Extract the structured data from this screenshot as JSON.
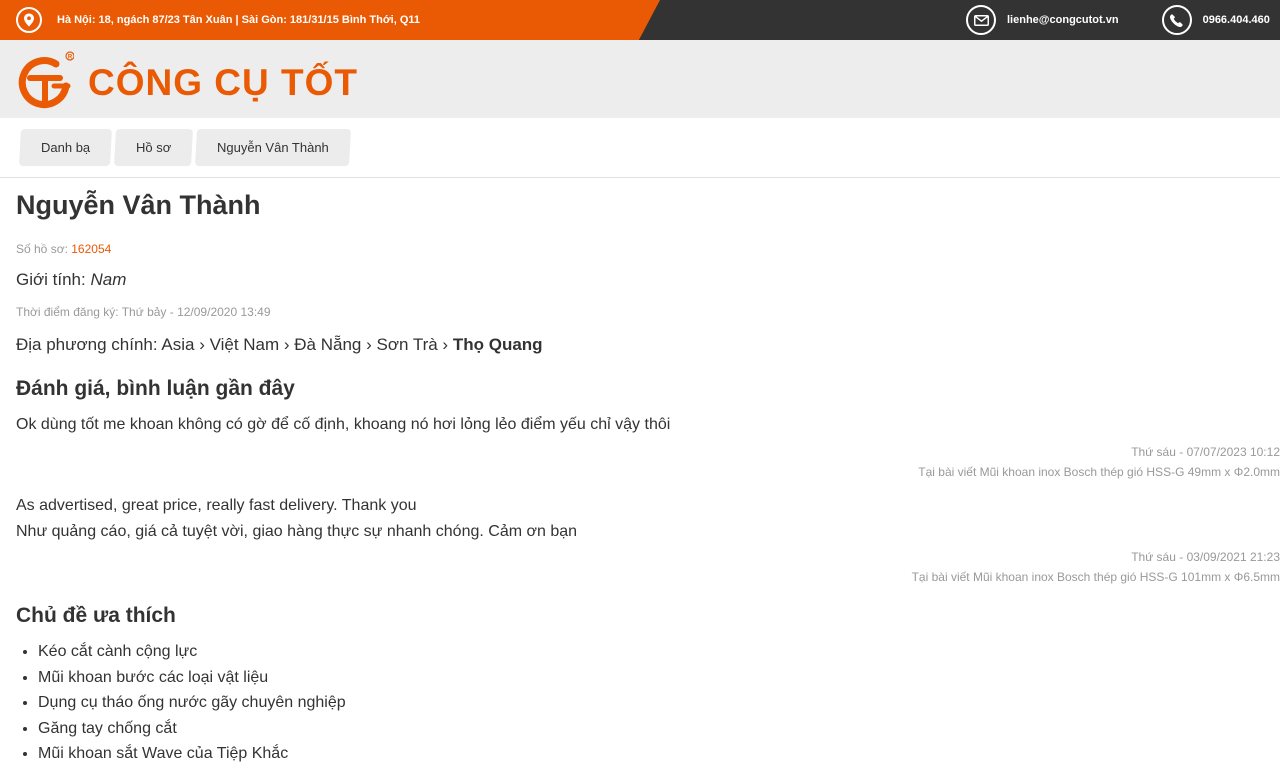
{
  "topbar": {
    "address": "Hà Nội: 18, ngách 87/23 Tân Xuân | Sài Gòn: 181/31/15 Bình Thới, Q11",
    "email": "lienhe@congcutot.vn",
    "phone": "0966.404.460"
  },
  "logo": {
    "text": "CÔNG CỤ TỐT",
    "mark_letters": "GT",
    "registered": "®"
  },
  "breadcrumb": [
    "Danh bạ",
    "Hồ sơ",
    "Nguyễn Vân Thành"
  ],
  "profile": {
    "name": "Nguyễn Vân Thành",
    "profile_no_label": "Số hồ sơ:",
    "profile_no": "162054",
    "gender_label": "Giới tính:",
    "gender": "Nam",
    "registered": "Thời điểm đăng ký: Thứ bảy - 12/09/2020 13:49",
    "locale_label": "Địa phương chính: Asia › Việt Nam › Đà Nẵng › Sơn Trà ›",
    "locale_last": "Thọ Quang"
  },
  "reviews_heading": "Đánh giá, bình luận gần đây",
  "reviews": [
    {
      "lines": [
        "Ok dùng tốt me khoan không có gờ để cố định, khoang nó hơi lỏng lẻo điểm yếu chỉ vậy thôi"
      ],
      "date": "Thứ sáu - 07/07/2023 10:12",
      "post": "Tại bài viết Mũi khoan inox Bosch thép gió HSS-G 49mm x Φ2.0mm"
    },
    {
      "lines": [
        "As advertised, great price, really fast delivery. Thank you",
        "Như quảng cáo, giá cả tuyệt vời, giao hàng thực sự nhanh chóng. Cảm ơn bạn"
      ],
      "date": "Thứ sáu - 03/09/2021 21:23",
      "post": "Tại bài viết Mũi khoan inox Bosch thép gió HSS-G 101mm x Φ6.5mm"
    }
  ],
  "favorites_heading": "Chủ đề ưa thích",
  "favorites": [
    "Kéo cắt cành cộng lực",
    "Mũi khoan bước các loại vật liệu",
    "Dụng cụ tháo ống nước gãy chuyên nghiệp",
    "Găng tay chống cắt",
    "Mũi khoan sắt Wave của Tiệp Khắc"
  ],
  "colors": {
    "brand_orange": "#ea5a04",
    "topbar_dark": "#333333",
    "header_bg": "#ededed"
  },
  "icons": {
    "address": "location-pin-icon",
    "email": "envelope-icon",
    "phone": "phone-icon"
  }
}
